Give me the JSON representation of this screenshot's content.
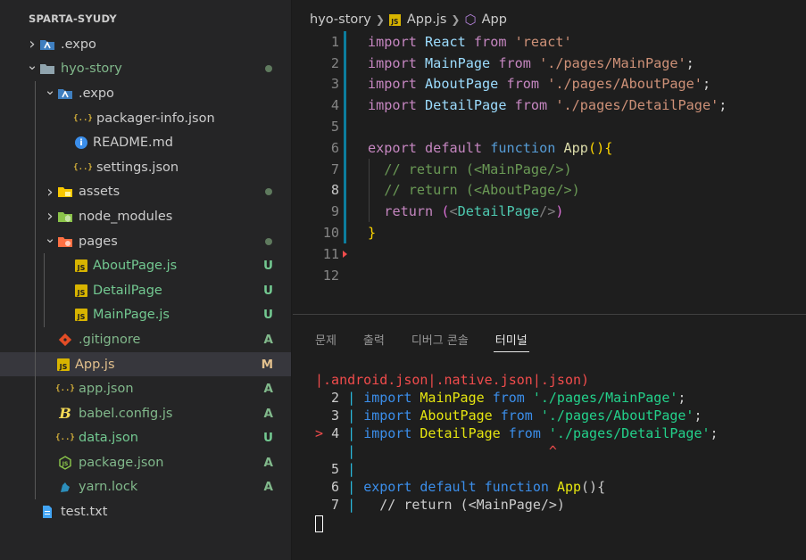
{
  "explorer": {
    "root_title": "SPARTA-SYUDY",
    "items": [
      {
        "label": ".expo",
        "depth": 0,
        "kind": "folder",
        "icon": "expo-folder-icon"
      },
      {
        "label": "hyo-story",
        "depth": 0,
        "kind": "folder-open",
        "icon": "folder-icon",
        "status": "dot",
        "name_class": "add"
      },
      {
        "label": ".expo",
        "depth": 1,
        "kind": "folder-open",
        "icon": "expo-folder-icon"
      },
      {
        "label": "packager-info.json",
        "depth": 2,
        "kind": "file",
        "icon": "json-icon"
      },
      {
        "label": "README.md",
        "depth": 2,
        "kind": "file",
        "icon": "info-icon"
      },
      {
        "label": "settings.json",
        "depth": 2,
        "kind": "file",
        "icon": "json-icon"
      },
      {
        "label": "assets",
        "depth": 1,
        "kind": "folder",
        "icon": "assets-folder-icon",
        "status": "dot",
        "name_class": "add"
      },
      {
        "label": "node_modules",
        "depth": 1,
        "kind": "folder",
        "icon": "node-folder-icon"
      },
      {
        "label": "pages",
        "depth": 1,
        "kind": "folder-open",
        "icon": "pages-folder-icon",
        "status": "dot",
        "name_class": "add"
      },
      {
        "label": "AboutPage.js",
        "depth": 2,
        "kind": "file",
        "icon": "js-icon",
        "badge": "U",
        "name_class": "unt"
      },
      {
        "label": "DetailPage",
        "depth": 2,
        "kind": "file",
        "icon": "js-icon",
        "badge": "U",
        "name_class": "unt"
      },
      {
        "label": "MainPage.js",
        "depth": 2,
        "kind": "file",
        "icon": "js-icon",
        "badge": "U",
        "name_class": "unt"
      },
      {
        "label": ".gitignore",
        "depth": 1,
        "kind": "file",
        "icon": "git-icon",
        "badge": "A",
        "name_class": "add"
      },
      {
        "label": "App.js",
        "depth": 1,
        "kind": "file",
        "icon": "js-icon",
        "badge": "M",
        "name_class": "mod",
        "selected": true
      },
      {
        "label": "app.json",
        "depth": 1,
        "kind": "file",
        "icon": "json-icon",
        "badge": "A",
        "name_class": "add"
      },
      {
        "label": "babel.config.js",
        "depth": 1,
        "kind": "file",
        "icon": "babel-icon",
        "badge": "A",
        "name_class": "add"
      },
      {
        "label": "data.json",
        "depth": 1,
        "kind": "file",
        "icon": "json-icon",
        "badge": "U",
        "name_class": "unt"
      },
      {
        "label": "package.json",
        "depth": 1,
        "kind": "file",
        "icon": "node-icon",
        "badge": "A",
        "name_class": "add"
      },
      {
        "label": "yarn.lock",
        "depth": 1,
        "kind": "file",
        "icon": "yarn-icon",
        "badge": "A",
        "name_class": "add"
      },
      {
        "label": "test.txt",
        "depth": 0,
        "kind": "file",
        "icon": "text-file-icon"
      }
    ]
  },
  "breadcrumb": {
    "folder": "hyo-story",
    "file": "App.js",
    "symbol": "App",
    "js_badge": "JS"
  },
  "editor": {
    "active_line": 8,
    "lines": [
      {
        "n": "1",
        "tokens": [
          [
            "kw",
            "import"
          ],
          [
            "pl",
            " "
          ],
          [
            "id",
            "React"
          ],
          [
            "pl",
            " "
          ],
          [
            "kw",
            "from"
          ],
          [
            "pl",
            " "
          ],
          [
            "str",
            "'react'"
          ]
        ]
      },
      {
        "n": "2",
        "tokens": [
          [
            "kw",
            "import"
          ],
          [
            "pl",
            " "
          ],
          [
            "id",
            "MainPage"
          ],
          [
            "pl",
            " "
          ],
          [
            "kw",
            "from"
          ],
          [
            "pl",
            " "
          ],
          [
            "str",
            "'./pages/MainPage'"
          ],
          [
            "pl",
            ";"
          ]
        ]
      },
      {
        "n": "3",
        "tokens": [
          [
            "kw",
            "import"
          ],
          [
            "pl",
            " "
          ],
          [
            "id",
            "AboutPage"
          ],
          [
            "pl",
            " "
          ],
          [
            "kw",
            "from"
          ],
          [
            "pl",
            " "
          ],
          [
            "str",
            "'./pages/AboutPage'"
          ],
          [
            "pl",
            ";"
          ]
        ]
      },
      {
        "n": "4",
        "tokens": [
          [
            "kw",
            "import"
          ],
          [
            "pl",
            " "
          ],
          [
            "id",
            "DetailPage"
          ],
          [
            "pl",
            " "
          ],
          [
            "kw",
            "from"
          ],
          [
            "pl",
            " "
          ],
          [
            "str",
            "'./pages/DetailPage'"
          ],
          [
            "pl",
            ";"
          ]
        ]
      },
      {
        "n": "5",
        "tokens": []
      },
      {
        "n": "6",
        "tokens": [
          [
            "kw",
            "export"
          ],
          [
            "pl",
            " "
          ],
          [
            "kw",
            "default"
          ],
          [
            "pl",
            " "
          ],
          [
            "kb",
            "function"
          ],
          [
            "pl",
            " "
          ],
          [
            "fn",
            "App"
          ],
          [
            "br1",
            "(){"
          ]
        ]
      },
      {
        "n": "7",
        "tokens": [
          [
            "pl",
            "  "
          ],
          [
            "cm",
            "// return (<MainPage/>)"
          ]
        ]
      },
      {
        "n": "8",
        "tokens": [
          [
            "pl",
            "  "
          ],
          [
            "cm",
            "// return (<AboutPage/>)"
          ]
        ]
      },
      {
        "n": "9",
        "tokens": [
          [
            "pl",
            "  "
          ],
          [
            "kw",
            "return"
          ],
          [
            "pl",
            " "
          ],
          [
            "br2",
            "("
          ],
          [
            "tagp",
            "<"
          ],
          [
            "tag",
            "DetailPage"
          ],
          [
            "tagp",
            "/>"
          ],
          [
            "br2",
            ")"
          ]
        ]
      },
      {
        "n": "10",
        "tokens": [
          [
            "br1",
            "}"
          ]
        ]
      },
      {
        "n": "11",
        "tokens": []
      },
      {
        "n": "12",
        "tokens": []
      }
    ]
  },
  "panel": {
    "tabs": [
      {
        "label": "문제",
        "active": false
      },
      {
        "label": "출력",
        "active": false
      },
      {
        "label": "디버그 콘솔",
        "active": false
      },
      {
        "label": "터미널",
        "active": true
      }
    ],
    "terminal_lines": [
      [
        [
          "tr",
          "|.android.json|.native.json|.json)"
        ]
      ],
      [
        [
          "tw",
          "  2 "
        ],
        [
          "tc",
          "| "
        ],
        [
          "tb",
          "import "
        ],
        [
          "ty",
          "MainPage "
        ],
        [
          "tb",
          "from "
        ],
        [
          "tg",
          "'./pages/MainPage'"
        ],
        [
          "tw",
          ";"
        ]
      ],
      [
        [
          "tw",
          "  3 "
        ],
        [
          "tc",
          "| "
        ],
        [
          "tb",
          "import "
        ],
        [
          "ty",
          "AboutPage "
        ],
        [
          "tb",
          "from "
        ],
        [
          "tg",
          "'./pages/AboutPage'"
        ],
        [
          "tw",
          ";"
        ]
      ],
      [
        [
          "tr",
          "> "
        ],
        [
          "tw",
          "4 "
        ],
        [
          "tc",
          "| "
        ],
        [
          "tb",
          "import "
        ],
        [
          "ty",
          "DetailPage "
        ],
        [
          "tb",
          "from "
        ],
        [
          "tg",
          "'./pages/DetailPage'"
        ],
        [
          "tw",
          ";"
        ]
      ],
      [
        [
          "tw",
          "    "
        ],
        [
          "tc",
          "| "
        ],
        [
          "tw",
          "                       "
        ],
        [
          "tr",
          "^"
        ]
      ],
      [
        [
          "tw",
          "  5 "
        ],
        [
          "tc",
          "|"
        ]
      ],
      [
        [
          "tw",
          "  6 "
        ],
        [
          "tc",
          "| "
        ],
        [
          "tb",
          "export "
        ],
        [
          "tb",
          "default "
        ],
        [
          "tb",
          "function "
        ],
        [
          "ty",
          "App"
        ],
        [
          "tw",
          "(){"
        ]
      ],
      [
        [
          "tw",
          "  7 "
        ],
        [
          "tc",
          "| "
        ],
        [
          "tw",
          "  // return (<MainPage/>)"
        ]
      ]
    ]
  },
  "colors": {
    "sidebar_bg": "#252526",
    "editor_bg": "#1e1e1e",
    "selected_row": "#37373d",
    "modified": "#e2c08d",
    "added": "#81b88b",
    "untracked": "#73c991"
  }
}
